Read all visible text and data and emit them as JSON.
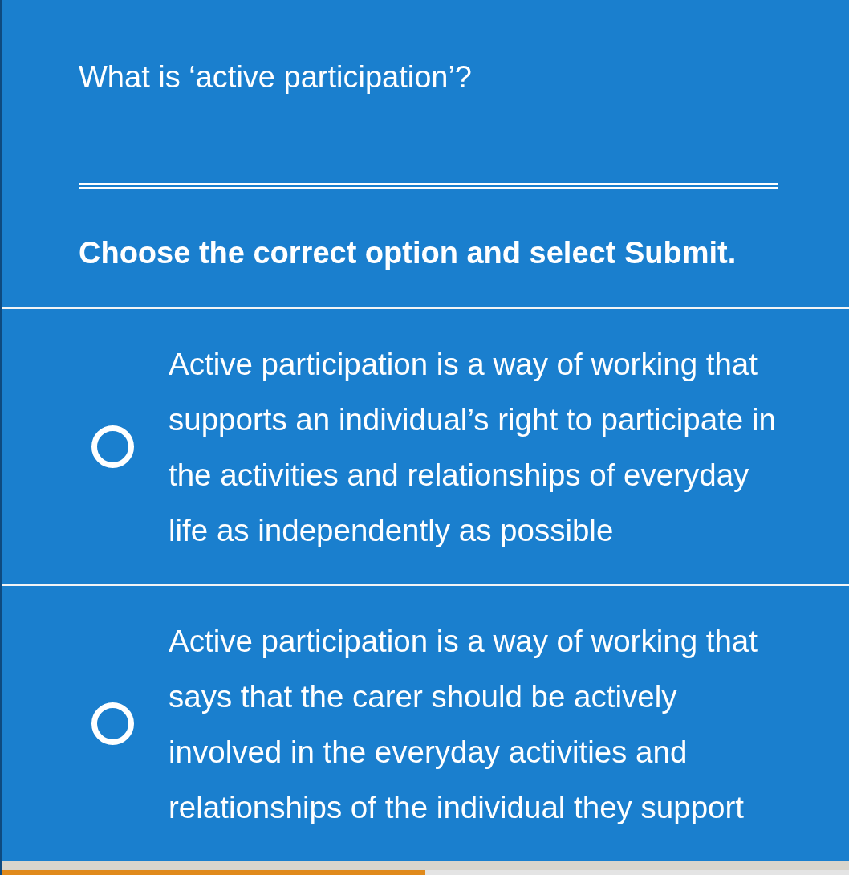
{
  "question": "What is ‘active participation’?",
  "instruction": "Choose the correct option and select Submit.",
  "options": [
    {
      "text": "Active participation is a way of working that supports an individual’s right to participate in the activities and relationships of everyday life as independently as possible",
      "selected": false
    },
    {
      "text": "Active participation is a way of working that says that the carer should be actively involved in the everyday activities and relationships of the individual they support",
      "selected": false
    }
  ],
  "progress": {
    "level": 0.5
  }
}
